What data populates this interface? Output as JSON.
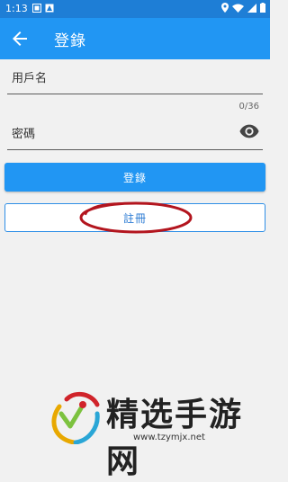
{
  "status_bar": {
    "time": "1:13",
    "icons": [
      "notification-icon-1",
      "notification-icon-2",
      "location-icon",
      "wifi-icon",
      "signal-icon",
      "battery-icon"
    ]
  },
  "app_bar": {
    "back_icon": "arrow-left-icon",
    "title": "登錄"
  },
  "form": {
    "username": {
      "label": "用戶名",
      "value": ""
    },
    "password": {
      "label": "密碼",
      "value": "",
      "counter": "0/36",
      "toggle_icon": "eye-icon"
    },
    "login_button": "登錄",
    "register_button": "註冊"
  },
  "watermark": {
    "title": "精选手游网",
    "url": "www.tzymjx.net"
  },
  "colors": {
    "status_bar": "#1e7ed6",
    "app_bar": "#2196f3",
    "primary": "#2196f3",
    "annotation": "#b3151e",
    "background": "#f1f1f1"
  }
}
